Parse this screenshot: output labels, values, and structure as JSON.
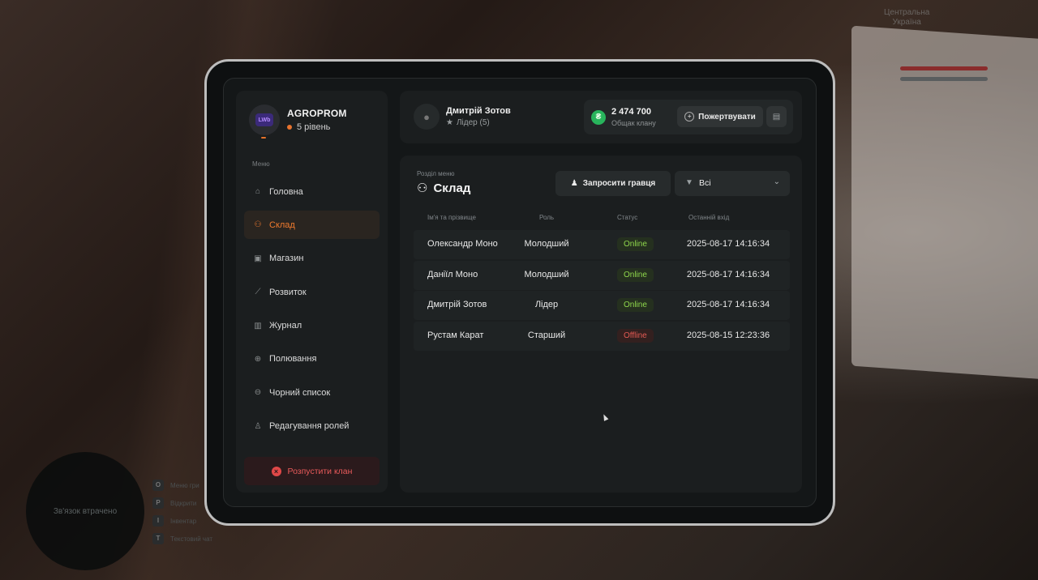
{
  "clan": {
    "name": "AGROPROM",
    "level": "5 рівень",
    "logo_text": "LWb"
  },
  "sidebar": {
    "menu_title": "Меню",
    "items": [
      {
        "label": "Головна",
        "icon": "home-icon"
      },
      {
        "label": "Склад",
        "icon": "members-icon",
        "active": true
      },
      {
        "label": "Магазин",
        "icon": "shop-icon"
      },
      {
        "label": "Розвиток",
        "icon": "chart-icon"
      },
      {
        "label": "Журнал",
        "icon": "book-icon"
      },
      {
        "label": "Полювання",
        "icon": "crosshair-icon"
      },
      {
        "label": "Чорний список",
        "icon": "blocked-icon"
      },
      {
        "label": "Редагування ролей",
        "icon": "user-edit-icon"
      }
    ],
    "disband_label": "Розпустити клан"
  },
  "header": {
    "user_name": "Дмитрій Зотов",
    "user_role": "Лідер (5)",
    "money_value": "2 474 700",
    "money_label": "Общак клану",
    "donate_label": "Пожертвувати"
  },
  "main": {
    "section_sub": "Розділ меню",
    "section_title": "Склад",
    "invite_label": "Запросити гравця",
    "filter_value": "Всі",
    "columns": [
      "Ім'я та прізвище",
      "Роль",
      "Статус",
      "Останній вхід"
    ],
    "rows": [
      {
        "name": "Олександр Моно",
        "role": "Молодший",
        "status": "Online",
        "last": "2025-08-17 14:16:34"
      },
      {
        "name": "Даніїл Моно",
        "role": "Молодший",
        "status": "Online",
        "last": "2025-08-17 14:16:34"
      },
      {
        "name": "Дмитрій Зотов",
        "role": "Лідер",
        "status": "Online",
        "last": "2025-08-17 14:16:34"
      },
      {
        "name": "Рустам Карат",
        "role": "Старший",
        "status": "Offline",
        "last": "2025-08-15 12:23:36"
      }
    ]
  },
  "hud": {
    "region_line1": "Центральна",
    "region_line2": "Україна",
    "minimap_text": "Зв'язок втрачено",
    "keyhints": [
      {
        "key": "O",
        "label": "Меню гри"
      },
      {
        "key": "P",
        "label": "Відкрити"
      },
      {
        "key": "I",
        "label": "Інвентар"
      },
      {
        "key": "T",
        "label": "Текстовий чат"
      }
    ]
  },
  "colors": {
    "accent": "#f07a2e",
    "online": "#8fd84c",
    "offline": "#e35a53",
    "coin": "#28b45c"
  }
}
